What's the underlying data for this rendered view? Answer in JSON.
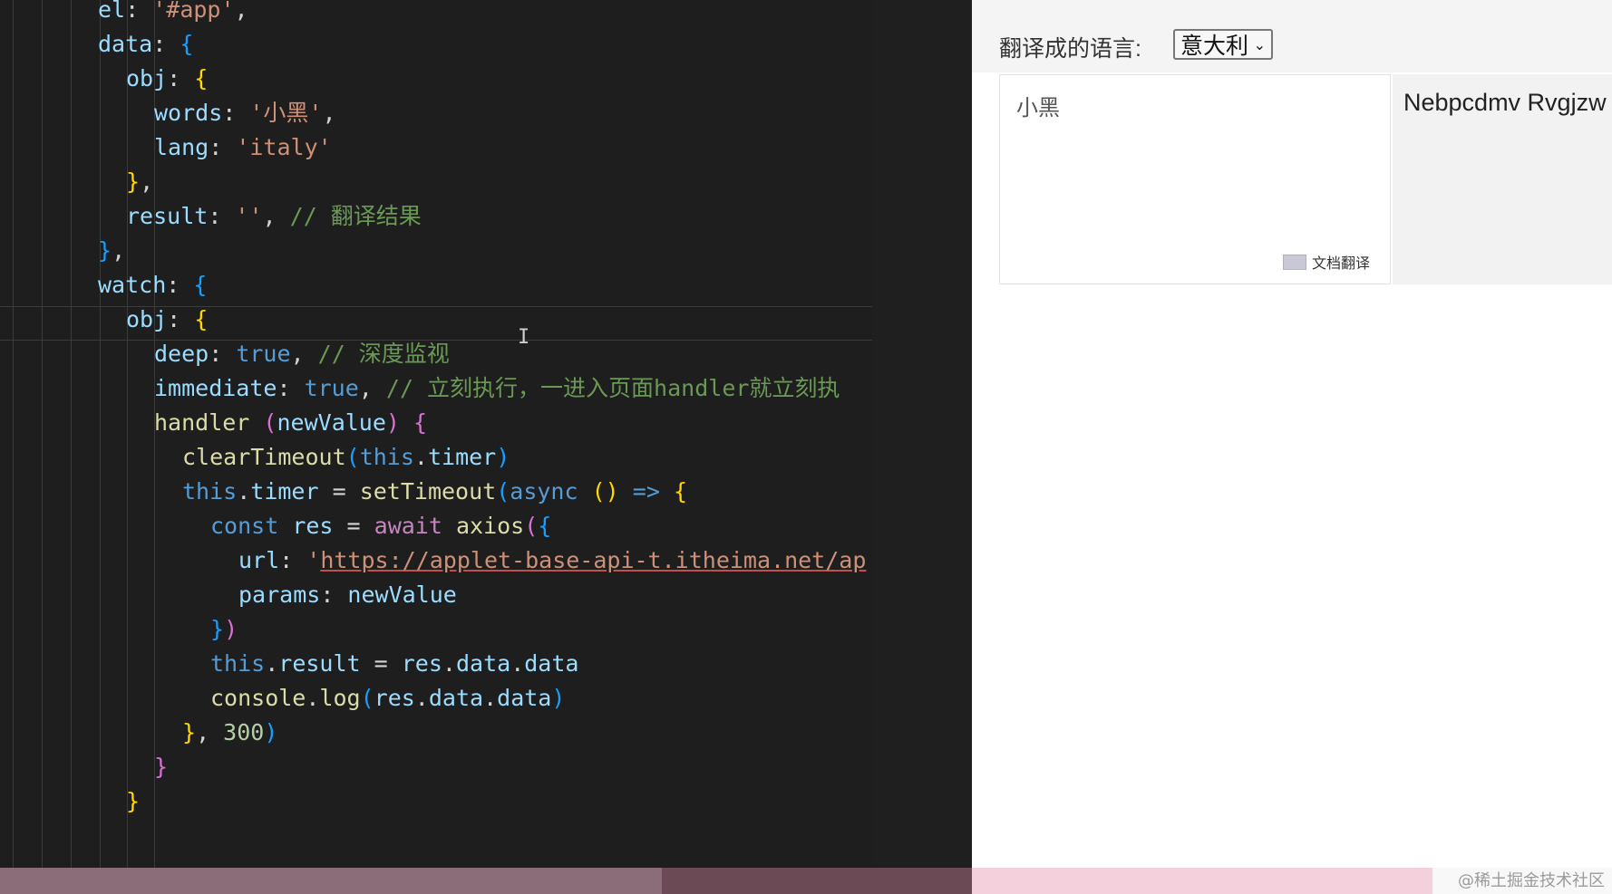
{
  "editor": {
    "lines": [
      [
        [
          "tok-key",
          "el"
        ],
        [
          "tok-punc",
          ": "
        ],
        [
          "tok-str",
          "'#app'"
        ],
        [
          "tok-punc",
          ","
        ]
      ],
      [
        [
          "tok-key",
          "data"
        ],
        [
          "tok-punc",
          ": "
        ],
        [
          "b3",
          "{"
        ]
      ],
      [
        [
          "tok-key",
          "obj"
        ],
        [
          "tok-punc",
          ": "
        ],
        [
          "b1",
          "{"
        ]
      ],
      [
        [
          "tok-key",
          "words"
        ],
        [
          "tok-punc",
          ": "
        ],
        [
          "tok-str",
          "'小黑'"
        ],
        [
          "tok-punc",
          ","
        ]
      ],
      [
        [
          "tok-key",
          "lang"
        ],
        [
          "tok-punc",
          ": "
        ],
        [
          "tok-str",
          "'italy'"
        ]
      ],
      [
        [
          "b1",
          "}"
        ],
        [
          "tok-punc",
          ","
        ]
      ],
      [
        [
          "tok-key",
          "result"
        ],
        [
          "tok-punc",
          ": "
        ],
        [
          "tok-str",
          "''"
        ],
        [
          "tok-punc",
          ", "
        ],
        [
          "tok-cmt",
          "// 翻译结果"
        ]
      ],
      [
        [
          "b3",
          "}"
        ],
        [
          "tok-punc",
          ","
        ]
      ],
      [
        [
          "tok-key",
          "watch"
        ],
        [
          "tok-punc",
          ": "
        ],
        [
          "b3",
          "{"
        ]
      ],
      [
        [
          "tok-key",
          "obj"
        ],
        [
          "tok-punc",
          ": "
        ],
        [
          "b1",
          "{"
        ]
      ],
      [
        [
          "tok-key",
          "deep"
        ],
        [
          "tok-punc",
          ": "
        ],
        [
          "tok-kw",
          "true"
        ],
        [
          "tok-punc",
          ", "
        ],
        [
          "tok-cmt",
          "// 深度监视"
        ]
      ],
      [
        [
          "tok-key",
          "immediate"
        ],
        [
          "tok-punc",
          ": "
        ],
        [
          "tok-kw",
          "true"
        ],
        [
          "tok-punc",
          ", "
        ],
        [
          "tok-cmt",
          "// 立刻执行，一进入页面handler就立刻执"
        ]
      ],
      [
        [
          "tok-fn",
          "handler"
        ],
        [
          "tok-punc",
          " "
        ],
        [
          "b2",
          "("
        ],
        [
          "tok-key",
          "newValue"
        ],
        [
          "b2",
          ")"
        ],
        [
          "tok-punc",
          " "
        ],
        [
          "b2",
          "{"
        ]
      ],
      [
        [
          "tok-fn",
          "clearTimeout"
        ],
        [
          "b3",
          "("
        ],
        [
          "tok-kw",
          "this"
        ],
        [
          "tok-punc",
          "."
        ],
        [
          "tok-key",
          "timer"
        ],
        [
          "b3",
          ")"
        ]
      ],
      [
        [
          "tok-kw",
          "this"
        ],
        [
          "tok-punc",
          "."
        ],
        [
          "tok-key",
          "timer"
        ],
        [
          "tok-punc",
          " = "
        ],
        [
          "tok-fn",
          "setTimeout"
        ],
        [
          "b3",
          "("
        ],
        [
          "tok-kw",
          "async"
        ],
        [
          "tok-punc",
          " "
        ],
        [
          "b1",
          "()"
        ],
        [
          "tok-punc",
          " "
        ],
        [
          "tok-kw",
          "=>"
        ],
        [
          "tok-punc",
          " "
        ],
        [
          "b1",
          "{"
        ]
      ],
      [
        [
          "tok-kw",
          "const"
        ],
        [
          "tok-punc",
          " "
        ],
        [
          "tok-key",
          "res"
        ],
        [
          "tok-punc",
          " = "
        ],
        [
          "tok-kw2",
          "await"
        ],
        [
          "tok-punc",
          " "
        ],
        [
          "tok-fn",
          "axios"
        ],
        [
          "b2",
          "("
        ],
        [
          "b3",
          "{"
        ]
      ],
      [
        [
          "tok-key",
          "url"
        ],
        [
          "tok-punc",
          ": "
        ],
        [
          "tok-str",
          "'"
        ],
        [
          "url-link",
          "https://applet-base-api-t.itheima.net/ap"
        ]
      ],
      [
        [
          "tok-key",
          "params"
        ],
        [
          "tok-punc",
          ": "
        ],
        [
          "tok-key",
          "newValue"
        ]
      ],
      [
        [
          "b3",
          "}"
        ],
        [
          "b2",
          ")"
        ]
      ],
      [
        [
          "tok-kw",
          "this"
        ],
        [
          "tok-punc",
          "."
        ],
        [
          "tok-key",
          "result"
        ],
        [
          "tok-punc",
          " = "
        ],
        [
          "tok-key",
          "res"
        ],
        [
          "tok-punc",
          "."
        ],
        [
          "tok-key",
          "data"
        ],
        [
          "tok-punc",
          "."
        ],
        [
          "tok-key",
          "data"
        ]
      ],
      [
        [
          "tok-fn",
          "console"
        ],
        [
          "tok-punc",
          "."
        ],
        [
          "tok-fn",
          "log"
        ],
        [
          "b3",
          "("
        ],
        [
          "tok-key",
          "res"
        ],
        [
          "tok-punc",
          "."
        ],
        [
          "tok-key",
          "data"
        ],
        [
          "tok-punc",
          "."
        ],
        [
          "tok-key",
          "data"
        ],
        [
          "b3",
          ")"
        ]
      ],
      [
        [
          "b1",
          "}"
        ],
        [
          "tok-punc",
          ", "
        ],
        [
          "tok-num",
          "300"
        ],
        [
          "b3",
          ")"
        ]
      ],
      [
        [
          "b2",
          "}"
        ]
      ],
      [
        [
          "b1",
          "}"
        ]
      ]
    ]
  },
  "browser": {
    "lang_label": "翻译成的语言:",
    "lang_selected": "意大利",
    "input_text": "小黑",
    "doc_translate_label": "文档翻译",
    "output_text": "Nebpcdmv Rvgjzw"
  },
  "watermark": "@稀土掘金技术社区",
  "colors": {
    "editor_bg": "#1e1e1e",
    "string": "#ce9178",
    "keyword": "#569cd6",
    "comment": "#6a9955",
    "property": "#9cdcfe",
    "function": "#dcdcaa"
  }
}
